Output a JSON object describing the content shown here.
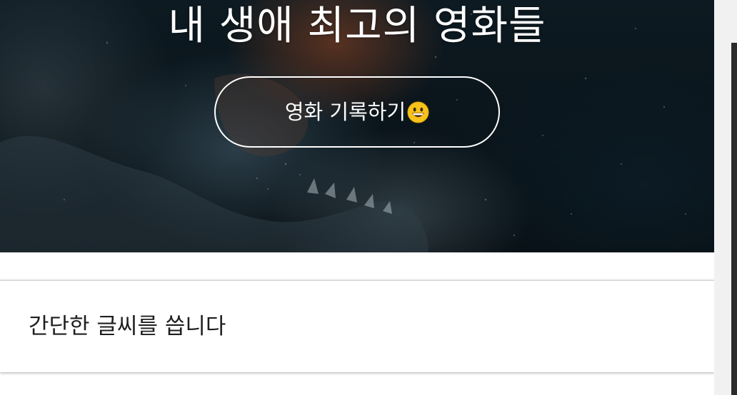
{
  "hero": {
    "title": "내 생애 최고의 영화들",
    "record_button_label": "영화 기록하기",
    "record_button_icon": "grinning-face-emoji"
  },
  "card": {
    "text": "간단한 글씨를 씁니다"
  },
  "colors": {
    "hero_dark": "#0a141a",
    "accent_glow": "#96461f",
    "text_on_hero": "#ffffff",
    "card_text": "#1f1f1f"
  }
}
